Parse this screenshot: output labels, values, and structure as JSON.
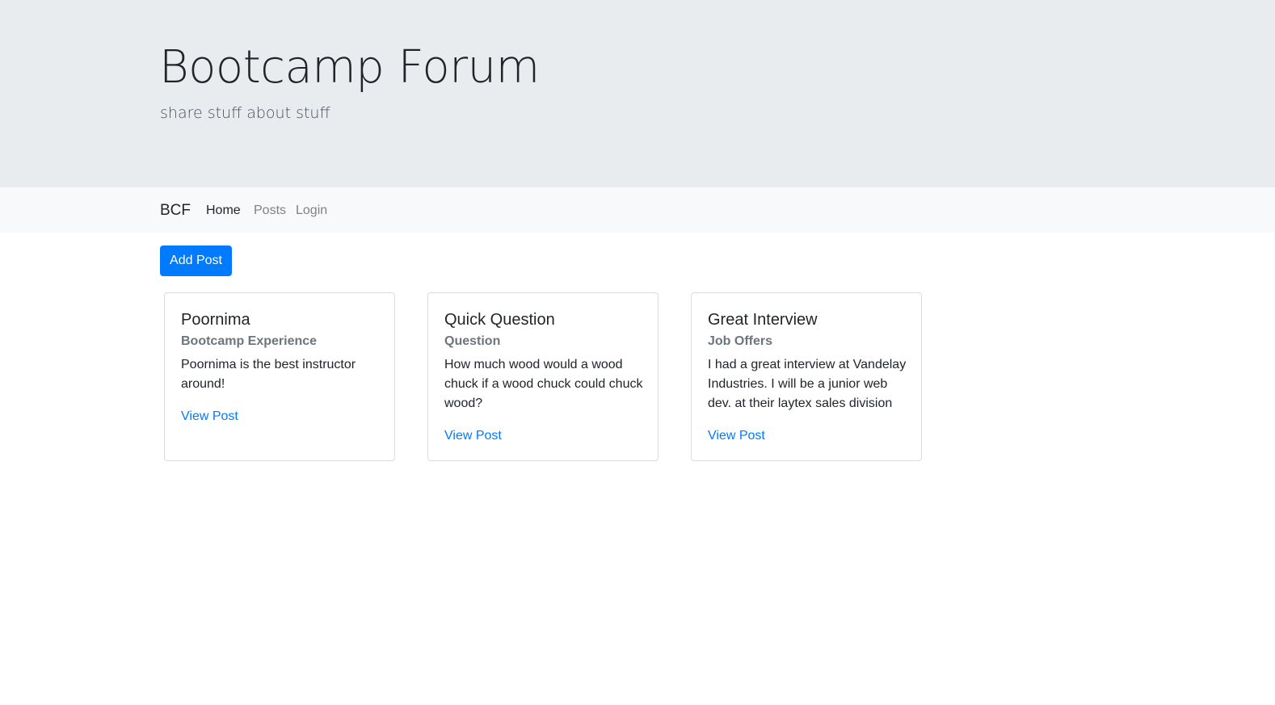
{
  "jumbotron": {
    "title": "Bootcamp Forum",
    "subtitle": "share stuff about stuff"
  },
  "navbar": {
    "brand": "BCF",
    "links": [
      {
        "label": "Home",
        "active": true
      },
      {
        "label": "Posts",
        "active": false
      },
      {
        "label": "Login",
        "active": false
      }
    ]
  },
  "actions": {
    "add_post_label": "Add Post"
  },
  "posts": [
    {
      "title": "Poornima",
      "category": "Bootcamp Experience",
      "body": "Poornima is the best instructor around!",
      "link_label": "View Post"
    },
    {
      "title": "Quick Question",
      "category": "Question",
      "body": "How much wood would a wood chuck if a wood chuck could chuck wood?",
      "link_label": "View Post"
    },
    {
      "title": "Great Interview",
      "category": "Job Offers",
      "body": "I had a great interview at Vandelay Industries. I will be a junior web dev. at their laytex sales division",
      "link_label": "View Post"
    }
  ],
  "colors": {
    "primary": "#007bff",
    "jumbotron_bg": "#e9ecef",
    "navbar_bg": "#f8f9fa",
    "muted_text": "#6c757d"
  }
}
